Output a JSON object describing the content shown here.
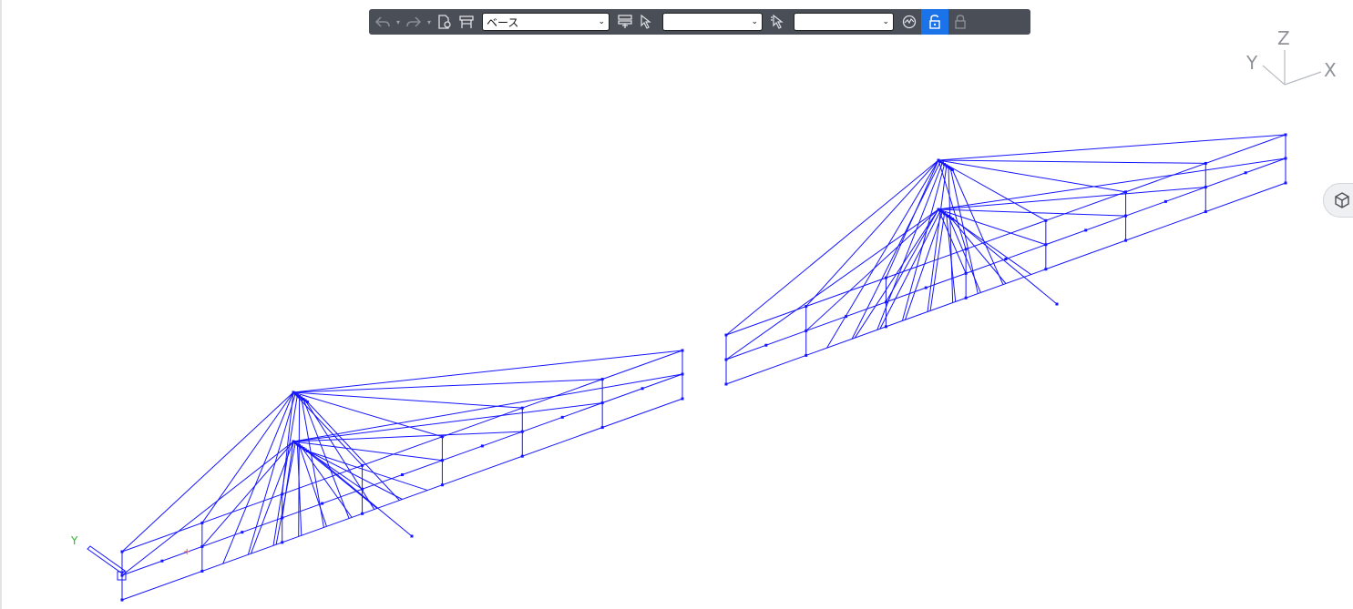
{
  "toolbar": {
    "undo_icon": "undo-icon",
    "redo_icon": "redo-icon",
    "dropdown_caret": "▾",
    "layer_select_value": "ベース",
    "filter_select_value": "",
    "selection_select_value": "",
    "accent_color": "#1a73e8",
    "background_color": "#4a4e56"
  },
  "axis_triad": {
    "z": "Z",
    "y": "Y",
    "x": "X",
    "color": "#8f9399"
  },
  "origin_marker": {
    "y_label": "Y",
    "y_color": "#36b536",
    "x_color": "#e05050"
  },
  "model": {
    "line_color": "#1515ff"
  }
}
